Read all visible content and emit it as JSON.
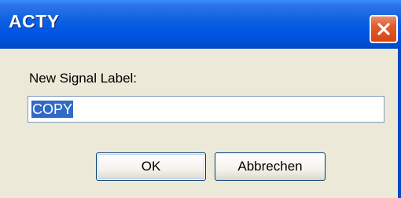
{
  "window": {
    "title": "ACTY"
  },
  "dialog": {
    "prompt_label": "New Signal Label:",
    "input_value": "COPY"
  },
  "buttons": {
    "ok_label": "OK",
    "cancel_label": "Abbrechen"
  },
  "icons": {
    "close": "close-icon"
  },
  "colors": {
    "titlebar": "#0054E3",
    "close_button": "#E25A2C",
    "dialog_bg": "#ECE9D8",
    "selection": "#316AC5"
  }
}
